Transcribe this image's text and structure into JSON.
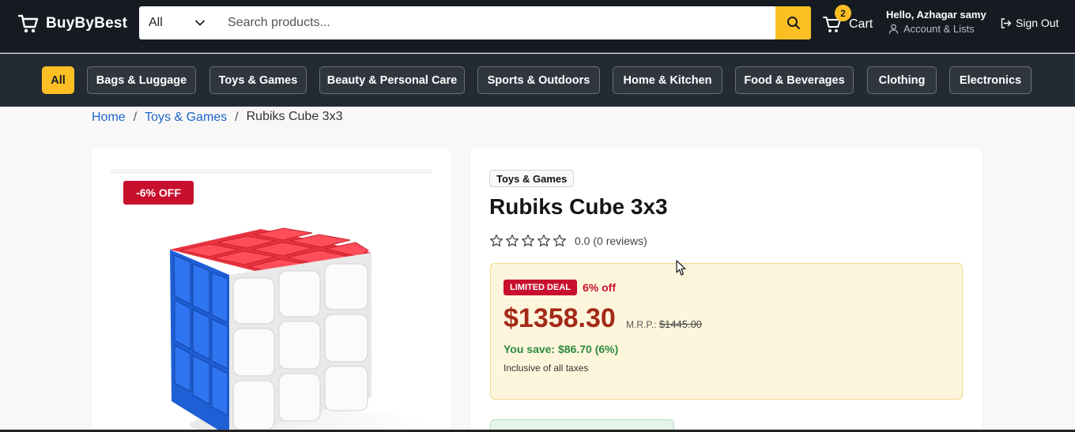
{
  "header": {
    "brand": "BuyByBest",
    "search": {
      "category": "All",
      "placeholder": "Search products..."
    },
    "cart": {
      "label": "Cart",
      "count": "2"
    },
    "account": {
      "greeting": "Hello, Azhagar samy",
      "sub_label": "Account & Lists"
    },
    "sign_out_label": "Sign Out",
    "accent_color": "#fbbf24"
  },
  "categories": [
    {
      "label": "All",
      "active": true
    },
    {
      "label": "Bags & Luggage",
      "active": false
    },
    {
      "label": "Toys & Games",
      "active": false
    },
    {
      "label": "Beauty & Personal Care",
      "active": false
    },
    {
      "label": "Sports & Outdoors",
      "active": false
    },
    {
      "label": "Home & Kitchen",
      "active": false
    },
    {
      "label": "Food & Beverages",
      "active": false
    },
    {
      "label": "Clothing",
      "active": false
    },
    {
      "label": "Electronics",
      "active": false
    }
  ],
  "breadcrumb": {
    "home": "Home",
    "category": "Toys & Games",
    "separator": "/",
    "current": "Rubiks Cube 3x3"
  },
  "product": {
    "discount_badge": "-6% OFF",
    "category_tag": "Toys & Games",
    "title": "Rubiks Cube 3x3",
    "rating_value": 0,
    "rating_max": 5,
    "rating_text": "0.0 (0 reviews)",
    "deal": {
      "badge": "LIMITED DEAL",
      "percent_off": "6% off",
      "price": "$1358.30",
      "mrp_label": "M.R.P.:",
      "mrp_value": "$1445.00",
      "savings": "You save: $86.70 (6%)",
      "tax_note": "Inclusive of all taxes"
    },
    "image_icon": "rubiks-cube-image"
  }
}
